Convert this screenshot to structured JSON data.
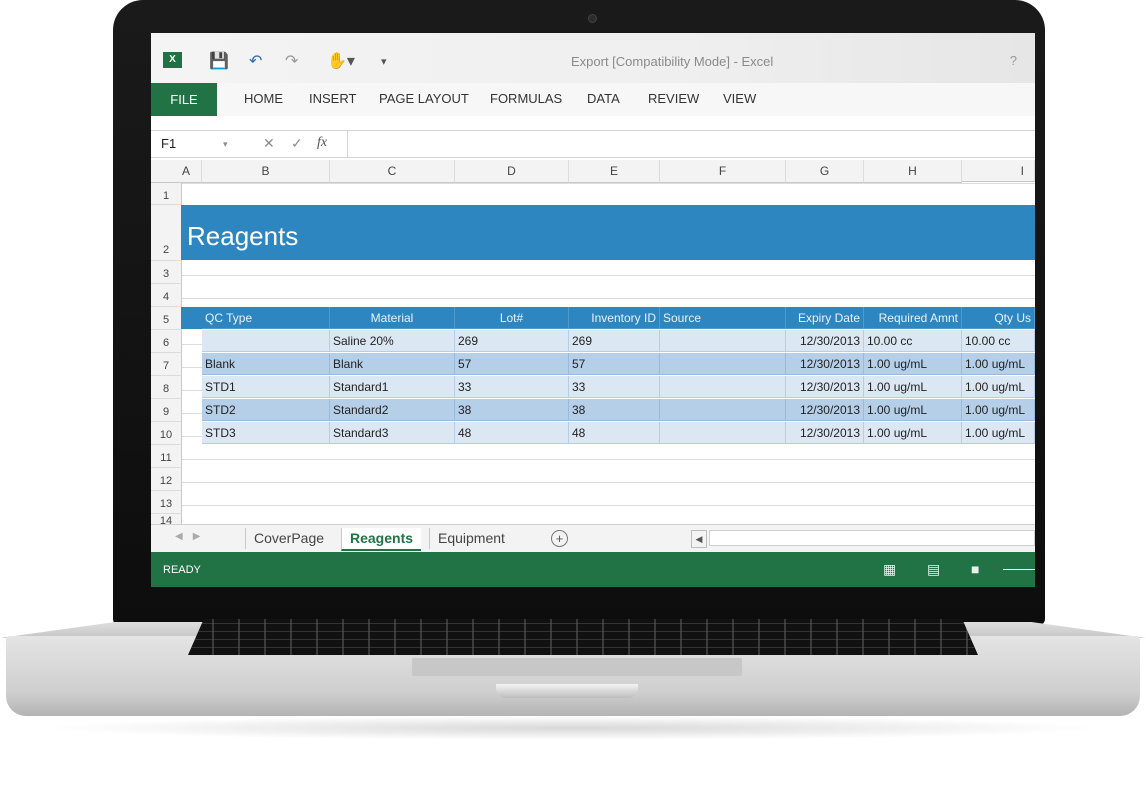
{
  "window": {
    "title": "Export  [Compatibility Mode] - Excel",
    "help": "?"
  },
  "quick_access": {
    "excel_logo": "X",
    "icons": [
      "save-icon",
      "undo-icon",
      "redo-icon",
      "touch-mode-icon",
      "customize-icon"
    ]
  },
  "ribbon": {
    "file": "FILE",
    "tabs": [
      "HOME",
      "INSERT",
      "PAGE LAYOUT",
      "FORMULAS",
      "DATA",
      "REVIEW",
      "VIEW"
    ]
  },
  "formula_bar": {
    "name_box": "F1",
    "fx": "fx",
    "value": ""
  },
  "columns": [
    "A",
    "B",
    "C",
    "D",
    "E",
    "F",
    "G",
    "H",
    "I"
  ],
  "row_numbers": [
    "1",
    "2",
    "3",
    "4",
    "5",
    "6",
    "7",
    "8",
    "9",
    "10",
    "11",
    "12",
    "13",
    "14"
  ],
  "sheet": {
    "title": "Reagents",
    "table_headers": [
      "QC Type",
      "Material",
      "Lot#",
      "Inventory ID",
      "Source",
      "Expiry Date",
      "Required Amnt",
      "Qty Us"
    ],
    "rows": [
      [
        "",
        "Saline 20%",
        "269",
        "269",
        "",
        "12/30/2013",
        "10.00 cc",
        "10.00 cc"
      ],
      [
        "Blank",
        "Blank",
        "57",
        "57",
        "",
        "12/30/2013",
        "1.00 ug/mL",
        "1.00 ug/mL"
      ],
      [
        "STD1",
        "Standard1",
        "33",
        "33",
        "",
        "12/30/2013",
        "1.00 ug/mL",
        "1.00 ug/mL"
      ],
      [
        "STD2",
        "Standard2",
        "38",
        "38",
        "",
        "12/30/2013",
        "1.00 ug/mL",
        "1.00 ug/mL"
      ],
      [
        "STD3",
        "Standard3",
        "48",
        "48",
        "",
        "12/30/2013",
        "1.00 ug/mL",
        "1.00 ug/mL"
      ]
    ]
  },
  "sheet_tabs": [
    {
      "label": "CoverPage",
      "active": false
    },
    {
      "label": "Reagents",
      "active": true
    },
    {
      "label": "Equipment",
      "active": false
    }
  ],
  "status": {
    "text": "READY"
  },
  "colors": {
    "excel_green": "#217346",
    "header_blue": "#2e86c1",
    "band_light": "#dbe7f3",
    "band_dark": "#b6cfe8"
  }
}
